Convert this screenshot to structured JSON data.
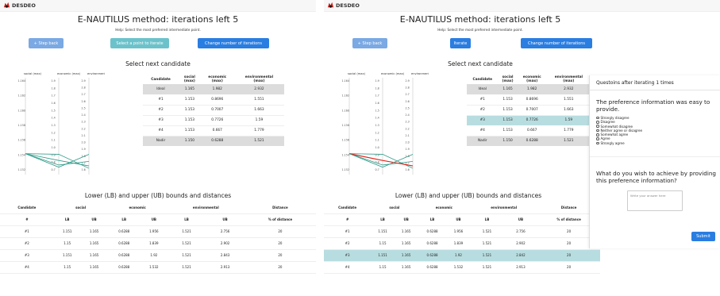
{
  "brand": {
    "name": "DESDEO"
  },
  "left": {
    "title": "E-NAUTILUS method: iterations left 5",
    "help": "Help: Select the most preferred intermediate point.",
    "buttons": {
      "step_back": "+ Step back",
      "select_point": "Select a point to iterate",
      "change_iterations": "Change number of iterations"
    },
    "select_next": "Select next candidate",
    "bounds_title": "Lower (LB) and upper (UB) bounds and distances"
  },
  "right": {
    "title": "E-NAUTILUS method: iterations left 5",
    "help": "Help: Select the most preferred intermediate point.",
    "buttons": {
      "step_back": "+ Step back",
      "iterate": "Iterate",
      "change_iterations": "Change number of iterations"
    },
    "select_next": "Select next candidate",
    "bounds_title": "Lower (LB) and upper (UB) bounds and distances"
  },
  "colors": {
    "primary": "#2a7de1",
    "light": "#7aa9e3",
    "teal": "#6cc2cb",
    "highlight": "#b8dde0",
    "line": "#2e9a89",
    "selected_line": "#e0251b",
    "gray": "#dcdcdc"
  },
  "pc": {
    "axis_labels": [
      "social (max)",
      "economic (max)",
      "environmental (max)"
    ],
    "ticks": {
      "social": [
        "1.164",
        "1.162",
        "1.160",
        "1.158",
        "1.156",
        "1.154",
        "1.152"
      ],
      "economic": [
        "1.9",
        "1.8",
        "1.7",
        "1.6",
        "1.5",
        "1.4",
        "1.3",
        "1.2",
        "1.1",
        "1.0",
        "0.9",
        "0.8",
        "0.7"
      ],
      "environmental": [
        "2.9",
        "2.8",
        "2.7",
        "2.6",
        "2.5",
        "2.4",
        "2.3",
        "2.2",
        "2.1",
        "2.0",
        "1.9",
        "1.8",
        "1.7",
        "1.6"
      ]
    }
  },
  "candidates": {
    "headers": [
      [
        "Candidate"
      ],
      [
        "social",
        "(max)"
      ],
      [
        "economic",
        "(max)"
      ],
      [
        "environmental",
        "(max)"
      ]
    ],
    "rows": [
      {
        "c": "Ideal",
        "s": "1.165",
        "e": "1.982",
        "v": "2.932"
      },
      {
        "c": "#1",
        "s": "1.153",
        "e": "0.8696",
        "v": "1.551"
      },
      {
        "c": "#2",
        "s": "1.153",
        "e": "0.7007",
        "v": "1.663"
      },
      {
        "c": "#3",
        "s": "1.153",
        "e": "0.7726",
        "v": "1.59"
      },
      {
        "c": "#4",
        "s": "1.153",
        "e": "0.667",
        "v": "1.779"
      },
      {
        "c": "Nadir",
        "s": "1.150",
        "e": "0.6288",
        "v": "1.521"
      }
    ]
  },
  "bounds": {
    "group_headers": [
      "Candidate",
      "social",
      "economic",
      "environmental",
      "Distance"
    ],
    "sub_headers": [
      "#",
      "LB",
      "UB",
      "LB",
      "UB",
      "LB",
      "UB",
      "% of distance"
    ],
    "rows_left": [
      [
        "#1",
        "1.151",
        "1.165",
        "0.6288",
        "1.956",
        "1.521",
        "2.756",
        "20"
      ],
      [
        "#2",
        "1.15",
        "1.165",
        "0.6288",
        "1.839",
        "1.521",
        "2.902",
        "20"
      ],
      [
        "#3",
        "1.151",
        "1.165",
        "0.6288",
        "1.92",
        "1.521",
        "2.843",
        "20"
      ],
      [
        "#4",
        "1.15",
        "1.165",
        "0.6288",
        "1.532",
        "1.521",
        "2.913",
        "20"
      ]
    ],
    "rows_right": [
      [
        "#1",
        "1.151",
        "1.165",
        "0.6288",
        "1.956",
        "1.521",
        "2.756",
        "20"
      ],
      [
        "#2",
        "1.15",
        "1.165",
        "0.6288",
        "1.839",
        "1.521",
        "2.902",
        "20"
      ],
      [
        "#3",
        "1.151",
        "1.165",
        "0.6288",
        "1.92",
        "1.521",
        "2.842",
        "20"
      ],
      [
        "#4",
        "1.15",
        "1.165",
        "0.6288",
        "1.532",
        "1.521",
        "2.913",
        "20"
      ]
    ],
    "selected_right": 2
  },
  "survey": {
    "heading": "Questoins after iterating 1 times",
    "q1": "The preference information was easy to provide.",
    "options": [
      "Strongly disagree",
      "Disagree",
      "Somewhat disagree",
      "Neither agree or disagree",
      "Somewhat agree",
      "Agree",
      "Strongly agree"
    ],
    "q2": "What do you wish to achieve by providing this preference information?",
    "placeholder": "Write your answer here",
    "submit": "Submit"
  }
}
